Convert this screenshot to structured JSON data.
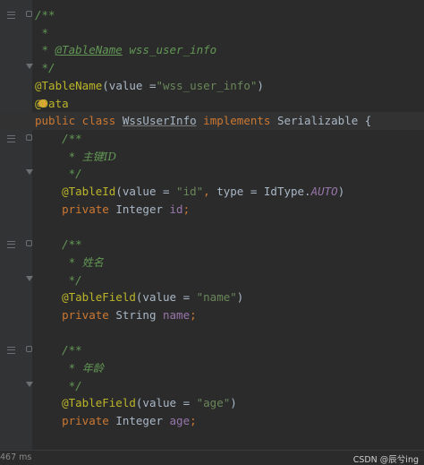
{
  "editor": {
    "lines": [
      {
        "gutter": "fold",
        "seg": [
          {
            "c": "c-doc",
            "t": "/**"
          }
        ]
      },
      {
        "gutter": "",
        "seg": [
          {
            "c": "c-doc",
            "t": " *"
          }
        ]
      },
      {
        "gutter": "",
        "seg": [
          {
            "c": "c-doc",
            "t": " * "
          },
          {
            "c": "c-doctag",
            "t": "@TableName"
          },
          {
            "c": "c-doc",
            "t": " wss_user_info"
          }
        ]
      },
      {
        "gutter": "foldend",
        "seg": [
          {
            "c": "c-doc",
            "t": " */"
          }
        ]
      },
      {
        "gutter": "",
        "seg": [
          {
            "c": "c-ann",
            "t": "@TableName"
          },
          {
            "c": "c-txt",
            "t": "(value ="
          },
          {
            "c": "c-str",
            "t": "\"wss_user_info\""
          },
          {
            "c": "c-txt",
            "t": ")"
          }
        ]
      },
      {
        "gutter": "",
        "bulb": true,
        "seg": [
          {
            "c": "c-ann",
            "t": "@Data"
          }
        ]
      },
      {
        "gutter": "",
        "current": true,
        "seg": [
          {
            "c": "c-kw",
            "t": "public class "
          },
          {
            "c": "c-cls-hl",
            "t": "WssUserInfo"
          },
          {
            "c": "c-kw",
            "t": " implements "
          },
          {
            "c": "c-txt",
            "t": "Serializable {"
          }
        ]
      },
      {
        "gutter": "fold",
        "seg": [
          {
            "c": "c-doc",
            "t": "    /**"
          }
        ]
      },
      {
        "gutter": "",
        "seg": [
          {
            "c": "c-doc",
            "t": "     * "
          },
          {
            "c": "c-cn",
            "t": "主键ID"
          }
        ]
      },
      {
        "gutter": "foldend",
        "seg": [
          {
            "c": "c-doc",
            "t": "     */"
          }
        ]
      },
      {
        "gutter": "",
        "seg": [
          {
            "c": "c-ann",
            "t": "    @TableId"
          },
          {
            "c": "c-txt",
            "t": "(value = "
          },
          {
            "c": "c-str",
            "t": "\"id\""
          },
          {
            "c": "c-kw",
            "t": ", "
          },
          {
            "c": "c-txt",
            "t": "type = IdType."
          },
          {
            "c": "c-const",
            "t": "AUTO"
          },
          {
            "c": "c-txt",
            "t": ")"
          }
        ]
      },
      {
        "gutter": "",
        "seg": [
          {
            "c": "c-kw",
            "t": "    private "
          },
          {
            "c": "c-txt",
            "t": "Integer "
          },
          {
            "c": "c-field",
            "t": "id"
          },
          {
            "c": "c-kw",
            "t": ";"
          }
        ]
      },
      {
        "gutter": "",
        "seg": []
      },
      {
        "gutter": "fold",
        "seg": [
          {
            "c": "c-doc",
            "t": "    /**"
          }
        ]
      },
      {
        "gutter": "",
        "seg": [
          {
            "c": "c-doc",
            "t": "     * "
          },
          {
            "c": "c-cn",
            "t": "姓名"
          }
        ]
      },
      {
        "gutter": "foldend",
        "seg": [
          {
            "c": "c-doc",
            "t": "     */"
          }
        ]
      },
      {
        "gutter": "",
        "seg": [
          {
            "c": "c-ann",
            "t": "    @TableField"
          },
          {
            "c": "c-txt",
            "t": "(value = "
          },
          {
            "c": "c-str",
            "t": "\"name\""
          },
          {
            "c": "c-txt",
            "t": ")"
          }
        ]
      },
      {
        "gutter": "",
        "seg": [
          {
            "c": "c-kw",
            "t": "    private "
          },
          {
            "c": "c-txt",
            "t": "String "
          },
          {
            "c": "c-field",
            "t": "name"
          },
          {
            "c": "c-kw",
            "t": ";"
          }
        ]
      },
      {
        "gutter": "",
        "seg": []
      },
      {
        "gutter": "fold",
        "seg": [
          {
            "c": "c-doc",
            "t": "    /**"
          }
        ]
      },
      {
        "gutter": "",
        "seg": [
          {
            "c": "c-doc",
            "t": "     * "
          },
          {
            "c": "c-cn",
            "t": "年龄"
          }
        ]
      },
      {
        "gutter": "foldend",
        "seg": [
          {
            "c": "c-doc",
            "t": "     */"
          }
        ]
      },
      {
        "gutter": "",
        "seg": [
          {
            "c": "c-ann",
            "t": "    @TableField"
          },
          {
            "c": "c-txt",
            "t": "(value = "
          },
          {
            "c": "c-str",
            "t": "\"age\""
          },
          {
            "c": "c-txt",
            "t": ")"
          }
        ]
      },
      {
        "gutter": "",
        "seg": [
          {
            "c": "c-kw",
            "t": "    private "
          },
          {
            "c": "c-txt",
            "t": "Integer "
          },
          {
            "c": "c-field",
            "t": "age"
          },
          {
            "c": "c-kw",
            "t": ";"
          }
        ]
      }
    ]
  },
  "status": {
    "left": "467 ms",
    "right": "CSDN @辰兮ing"
  },
  "colors": {
    "background": "#2b2b2b",
    "comment": "#629755",
    "annotation": "#bbb529",
    "keyword": "#cc7832",
    "string": "#6a8759",
    "field": "#9876aa",
    "text": "#a9b7c6"
  }
}
